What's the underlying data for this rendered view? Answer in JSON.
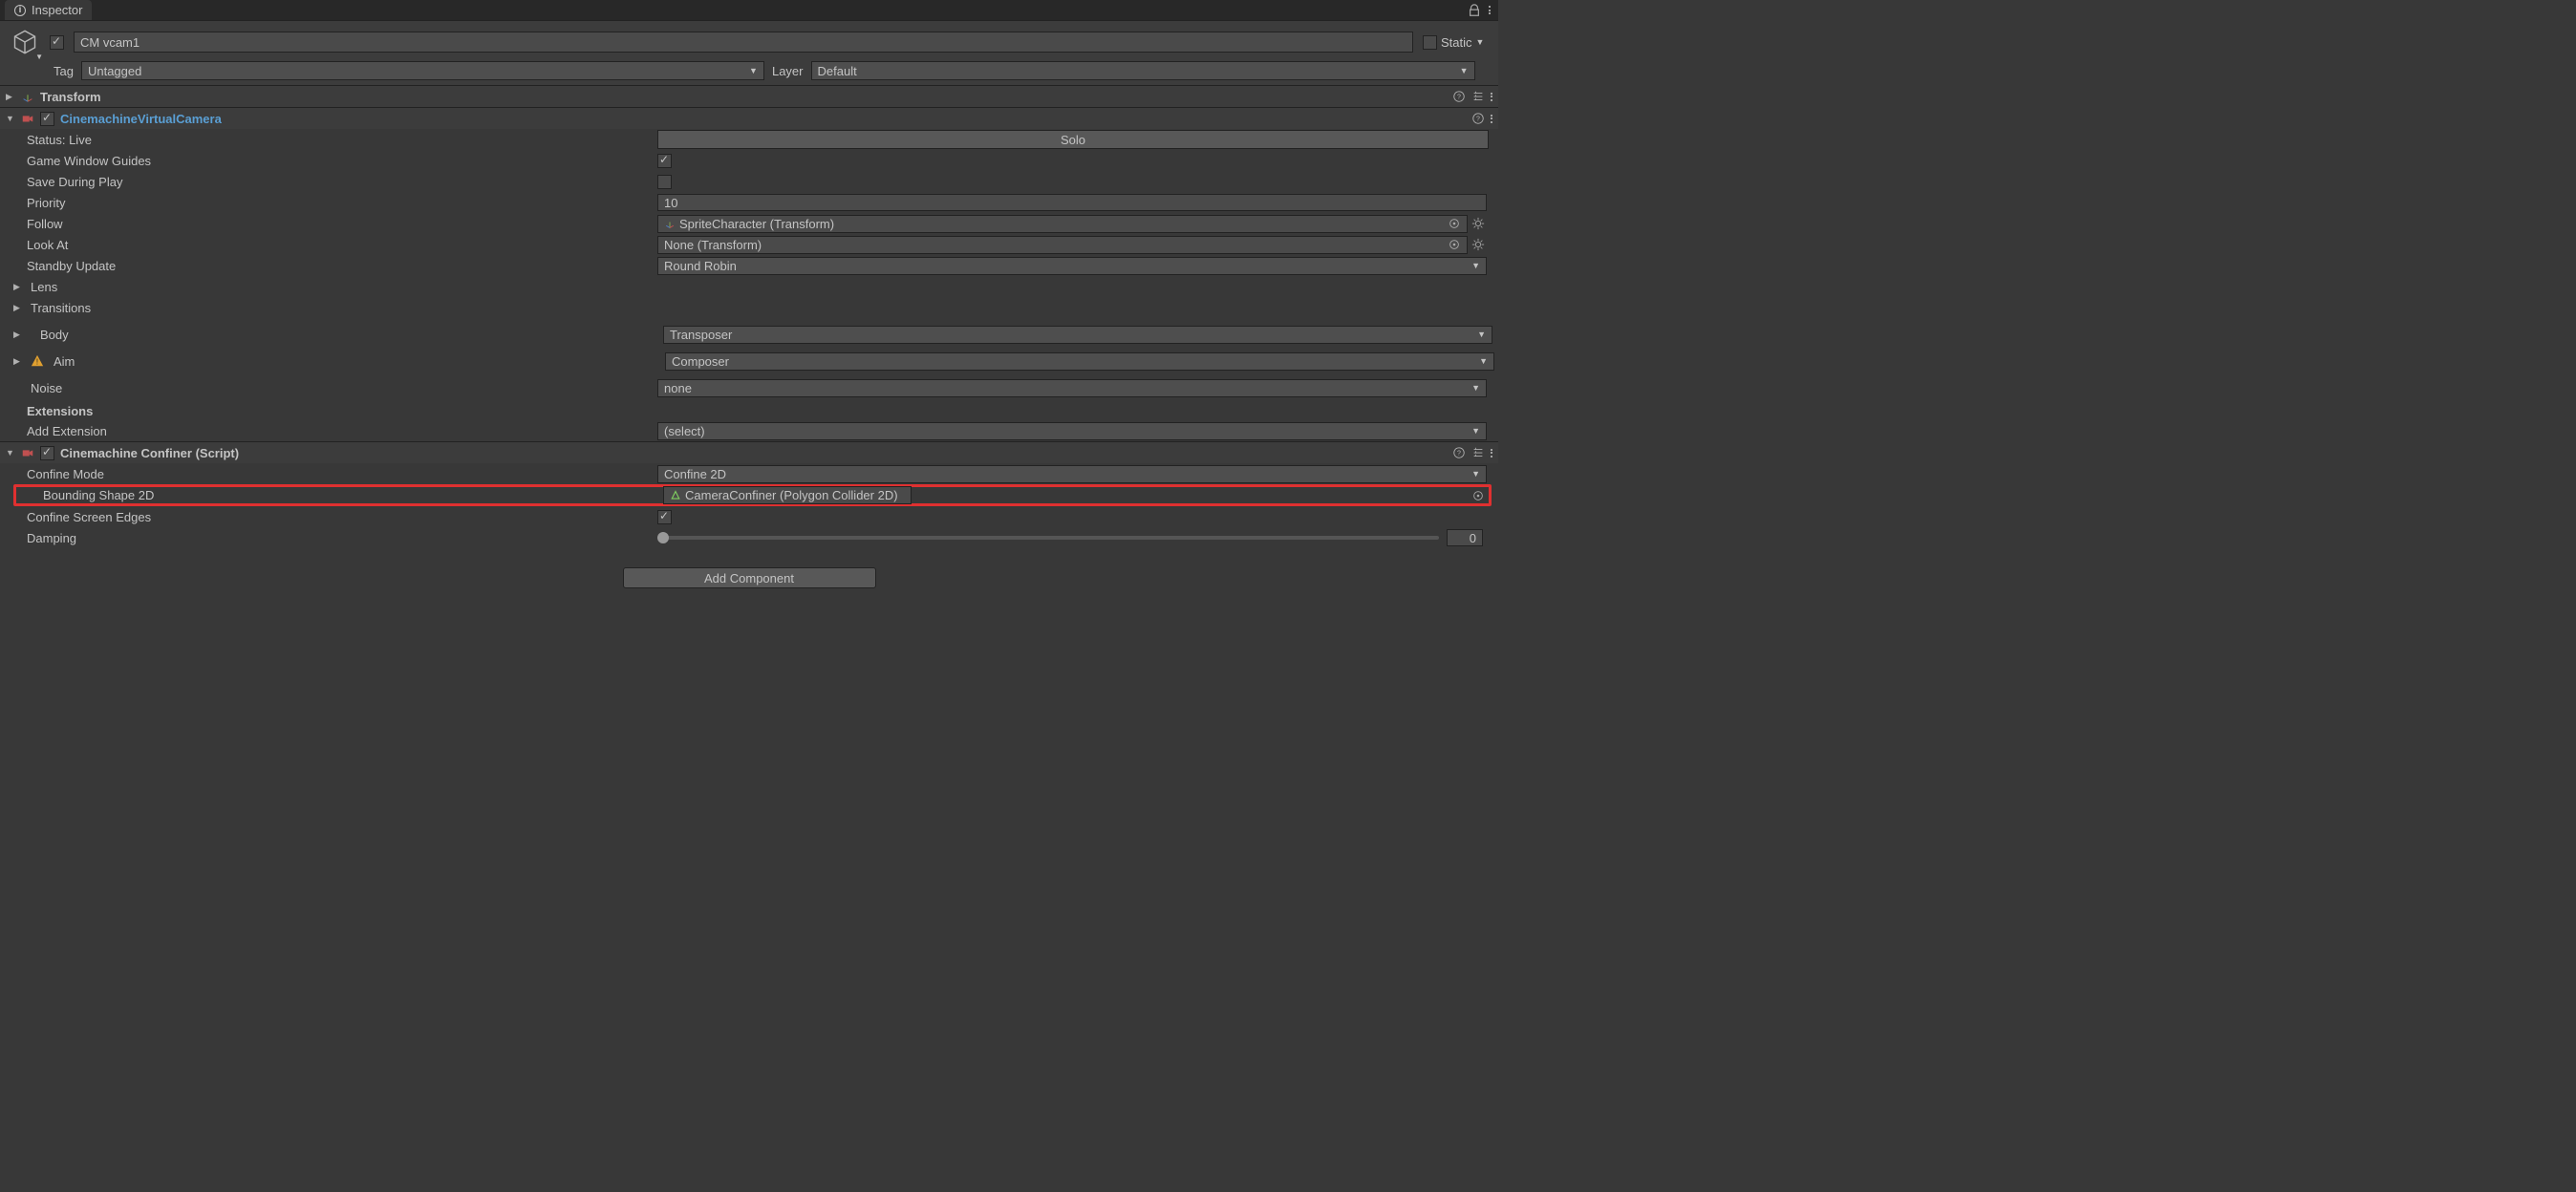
{
  "tab": {
    "title": "Inspector"
  },
  "header": {
    "name": "CM vcam1",
    "enabled": true,
    "static_label": "Static",
    "tag_label": "Tag",
    "tag_value": "Untagged",
    "layer_label": "Layer",
    "layer_value": "Default"
  },
  "transform": {
    "title": "Transform"
  },
  "vcam": {
    "title": "CinemachineVirtualCamera",
    "status_label": "Status: Live",
    "solo_label": "Solo",
    "rows": {
      "gwg": {
        "label": "Game Window Guides",
        "value": true
      },
      "sdp": {
        "label": "Save During Play",
        "value": false
      },
      "priority": {
        "label": "Priority",
        "value": "10"
      },
      "follow": {
        "label": "Follow",
        "value": "SpriteCharacter (Transform)"
      },
      "lookat": {
        "label": "Look At",
        "value": "None (Transform)"
      },
      "standby": {
        "label": "Standby Update",
        "value": "Round Robin"
      },
      "lens": {
        "label": "Lens"
      },
      "transitions": {
        "label": "Transitions"
      },
      "body": {
        "label": "Body",
        "value": "Transposer"
      },
      "aim": {
        "label": "Aim",
        "value": "Composer"
      },
      "noise": {
        "label": "Noise",
        "value": "none"
      }
    },
    "extensions_label": "Extensions",
    "add_ext": {
      "label": "Add Extension",
      "value": "(select)"
    }
  },
  "confiner": {
    "title": "Cinemachine Confiner (Script)",
    "rows": {
      "mode": {
        "label": "Confine Mode",
        "value": "Confine 2D"
      },
      "shape": {
        "label": "Bounding Shape 2D",
        "value": "CameraConfiner (Polygon Collider 2D)"
      },
      "edges": {
        "label": "Confine Screen Edges",
        "value": true
      },
      "damping": {
        "label": "Damping",
        "value": "0"
      }
    }
  },
  "add_component": "Add Component"
}
